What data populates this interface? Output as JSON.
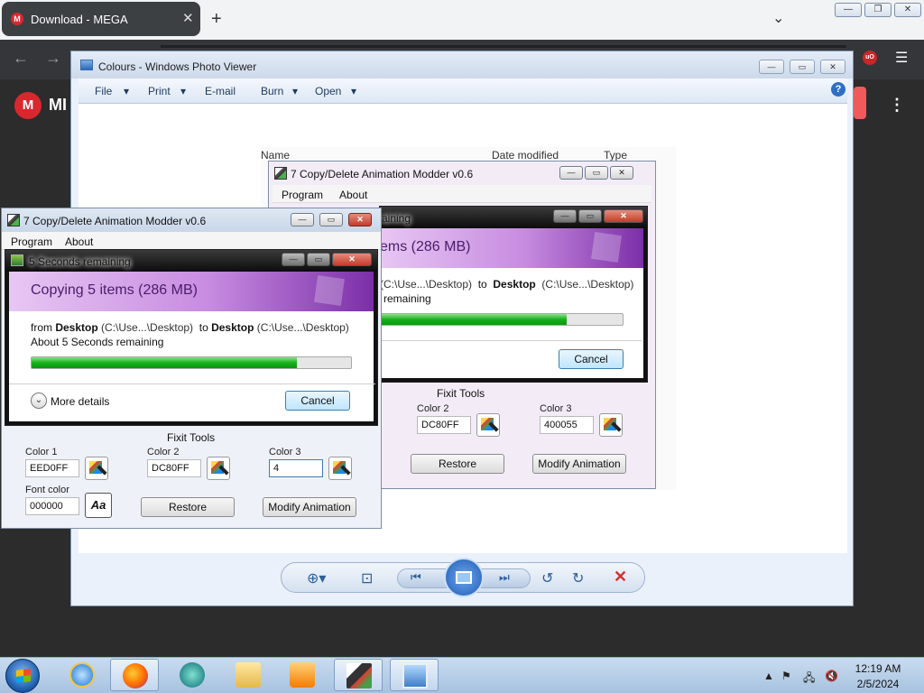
{
  "browser": {
    "tab_title": "Download - MEGA",
    "tab_favicon": "M",
    "new_tab": "+",
    "window_controls": [
      "—",
      "❐",
      "✕"
    ]
  },
  "page": {
    "logo_letter": "M",
    "logo_text": "MI"
  },
  "photo_viewer": {
    "title": "Colours - Windows Photo Viewer",
    "menu": [
      "File",
      "Print",
      "E-mail",
      "Burn",
      "Open"
    ],
    "file_list_headers": [
      "Name",
      "Date modified",
      "Type"
    ]
  },
  "modder_front": {
    "title": "7 Copy/Delete Animation Modder v0.6",
    "menu": [
      "Program",
      "About"
    ],
    "fixit_label": "Fixit Tools",
    "color1_label": "Color 1",
    "color1_value": "EED0FF",
    "color2_label": "Color 2",
    "color2_value": "DC80FF",
    "color3_label": "Color 3",
    "color3_value": "4",
    "font_color_label": "Font color",
    "font_color_value": "000000",
    "font_button": "Aa",
    "restore": "Restore",
    "modify": "Modify Animation"
  },
  "modder_back": {
    "title": "7 Copy/Delete Animation Modder v0.6",
    "menu": [
      "Program",
      "About"
    ],
    "fixit_label": "Fixit Tools",
    "color2_label": "Color 2",
    "color2_value": "DC80FF",
    "color3_label": "Color 3",
    "color3_value": "400055",
    "restore": "Restore",
    "modify": "Modify Animation"
  },
  "copy_front": {
    "title": "5 Seconds remaining",
    "banner": "Copying 5 items (286 MB)",
    "from_word": "from",
    "from_name": "Desktop",
    "from_path": "(C:\\Use...\\Desktop)",
    "to_word": "to",
    "to_name": "Desktop",
    "to_path": "(C:\\Use...\\Desktop)",
    "remaining": "About 5 Seconds remaining",
    "progress": 0.83,
    "more_details": "More details",
    "cancel": "Cancel"
  },
  "copy_back": {
    "title_fragment": "aining",
    "banner_fragment": "ems (286 MB)",
    "path_fragment": "(C:\\Use...\\Desktop)",
    "to_word": "to",
    "to_name": "Desktop",
    "to_path": "(C:\\Use...\\Desktop)",
    "remaining_fragment": "remaining",
    "progress": 0.77,
    "cancel": "Cancel"
  },
  "taskbar": {
    "time": "12:19 AM",
    "date": "2/5/2024",
    "items": [
      "ie-icon",
      "firefox-icon",
      "orb-icon",
      "explorer-icon",
      "media-icon",
      "modder-icon",
      "photo-viewer-icon"
    ]
  },
  "colors": {
    "banner_start": "#e7c7f3",
    "banner_end": "#7b2fa8",
    "progress_green": "#15b21a",
    "close_red": "#c43c2c"
  }
}
